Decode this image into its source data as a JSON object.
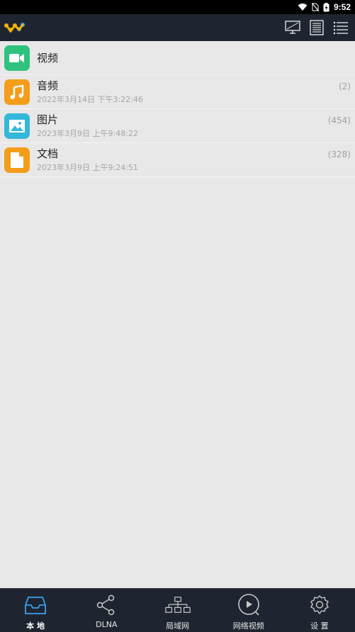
{
  "status_bar": {
    "time": "9:52"
  },
  "toolbar": {
    "logo": "app-logo",
    "actions": [
      "screen-icon",
      "document-view-icon",
      "list-view-icon"
    ]
  },
  "list": [
    {
      "name": "视频",
      "date": "",
      "count": "",
      "icon": "video-icon",
      "color": "#2ec27e"
    },
    {
      "name": "音频",
      "date": "2022年3月14日 下午3:22:46",
      "count": "(2)",
      "icon": "music-icon",
      "color": "#f49d1a"
    },
    {
      "name": "图片",
      "date": "2023年3月9日 上午9:48:22",
      "count": "(454)",
      "icon": "image-icon",
      "color": "#34b8d9"
    },
    {
      "name": "文档",
      "date": "2023年3月9日 上午9:24:51",
      "count": "(328)",
      "icon": "document-icon",
      "color": "#f49d1a"
    }
  ],
  "bottom_nav": [
    {
      "label": "本 地",
      "icon": "inbox-icon",
      "active": true
    },
    {
      "label": "DLNA",
      "icon": "share-icon",
      "active": false
    },
    {
      "label": "局域网",
      "icon": "network-icon",
      "active": false
    },
    {
      "label": "网络视频",
      "icon": "play-circle-icon",
      "active": false
    },
    {
      "label": "设 置",
      "icon": "gear-icon",
      "active": false
    }
  ],
  "colors": {
    "bar_bg": "#1f2530",
    "list_bg": "#e8e8e8",
    "active_blue": "#3a9ff0"
  }
}
